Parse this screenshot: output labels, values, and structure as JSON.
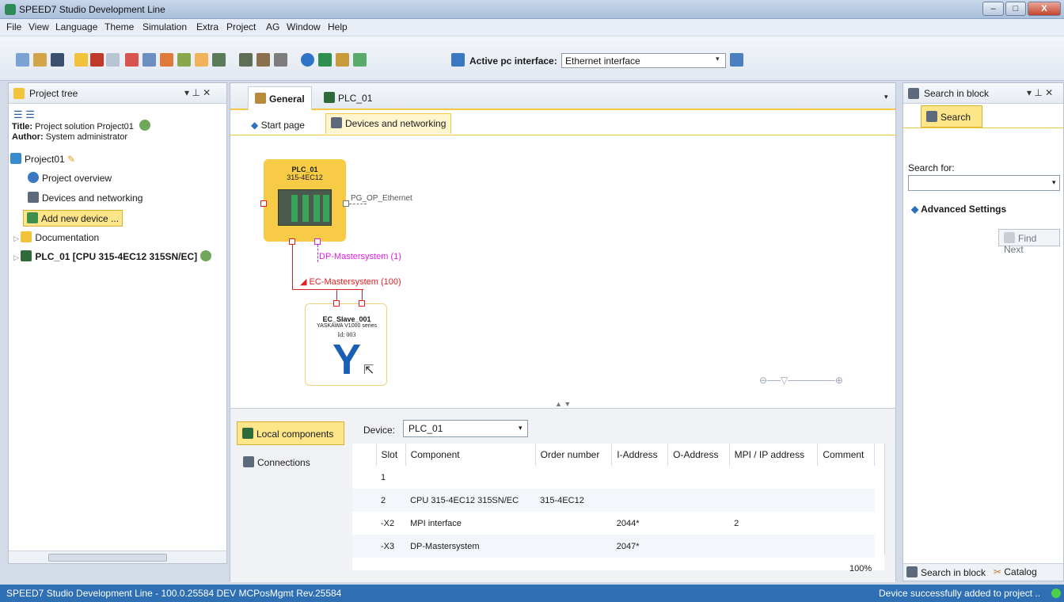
{
  "window": {
    "title": "SPEED7 Studio Development Line",
    "min": "–",
    "max": "□",
    "close": "X"
  },
  "menu": [
    "File",
    "View",
    "Language",
    "Theme",
    "Simulation",
    "Extra",
    "Project",
    "AG",
    "Window",
    "Help"
  ],
  "toolbar": {
    "interface_label": "Active pc interface:",
    "interface_value": "Ethernet interface"
  },
  "project_tree": {
    "title": "Project tree",
    "title_label": "Title:",
    "title_value": "Project solution Project01",
    "author_label": "Author:",
    "author_value": "System administrator",
    "items": [
      {
        "label": "Project01",
        "icon": "project-icon"
      },
      {
        "label": "Project overview",
        "icon": "info-icon"
      },
      {
        "label": "Devices and networking",
        "icon": "network-icon"
      },
      {
        "label": "Add new device ...",
        "icon": "add-device-icon"
      },
      {
        "label": "Documentation",
        "icon": "folder-icon"
      },
      {
        "label": "PLC_01 [CPU 315-4EC12 315SN/EC]",
        "icon": "plc-icon"
      }
    ]
  },
  "center": {
    "tabs": [
      "General",
      "PLC_01"
    ],
    "subtabs": [
      "Start page",
      "Devices and networking"
    ],
    "plc": {
      "name": "PLC_01",
      "model": "315-4EC12",
      "port_label": "PG_OP_Ethernet"
    },
    "dp_label": "DP-Mastersystem (1)",
    "ec_label": "EC-Mastersystem (100)",
    "slave": {
      "name": "EC_Slave_001",
      "series": "YASKAWA V1000 series",
      "id": "Id: 003",
      "logo": "Y"
    },
    "zoom": "100%"
  },
  "bottom": {
    "tabs": [
      "Local components",
      "Connections"
    ],
    "device_label": "Device:",
    "device_value": "PLC_01",
    "columns": [
      "Slot",
      "Component",
      "Order number",
      "I-Address",
      "O-Address",
      "MPI / IP address",
      "Comment"
    ],
    "rows": [
      [
        "1",
        "",
        "",
        "",
        "",
        "",
        ""
      ],
      [
        "2",
        "CPU 315-4EC12 315SN/EC",
        "315-4EC12",
        "",
        "",
        "",
        ""
      ],
      [
        "-X2",
        "MPI interface",
        "",
        "2044*",
        "",
        "2",
        ""
      ],
      [
        "-X3",
        "DP-Mastersystem",
        "",
        "2047*",
        "",
        "",
        ""
      ]
    ]
  },
  "right": {
    "title": "Search in block",
    "search_button": "Search",
    "search_for": "Search for:",
    "advanced": "Advanced Settings",
    "find_next": "Find Next",
    "bottom_tabs": [
      "Search in block",
      "Catalog"
    ]
  },
  "status": {
    "left": "SPEED7 Studio Development Line - 100.0.25584 DEV MCPosMgmt Rev.25584",
    "right": "Device successfully added to project .."
  },
  "colors": {
    "accent": "#f5c842",
    "status_bar": "#2f6fb3",
    "red_bus": "#e02020",
    "magenta_bus": "#e020e0",
    "logo_blue": "#1a5fb4"
  }
}
